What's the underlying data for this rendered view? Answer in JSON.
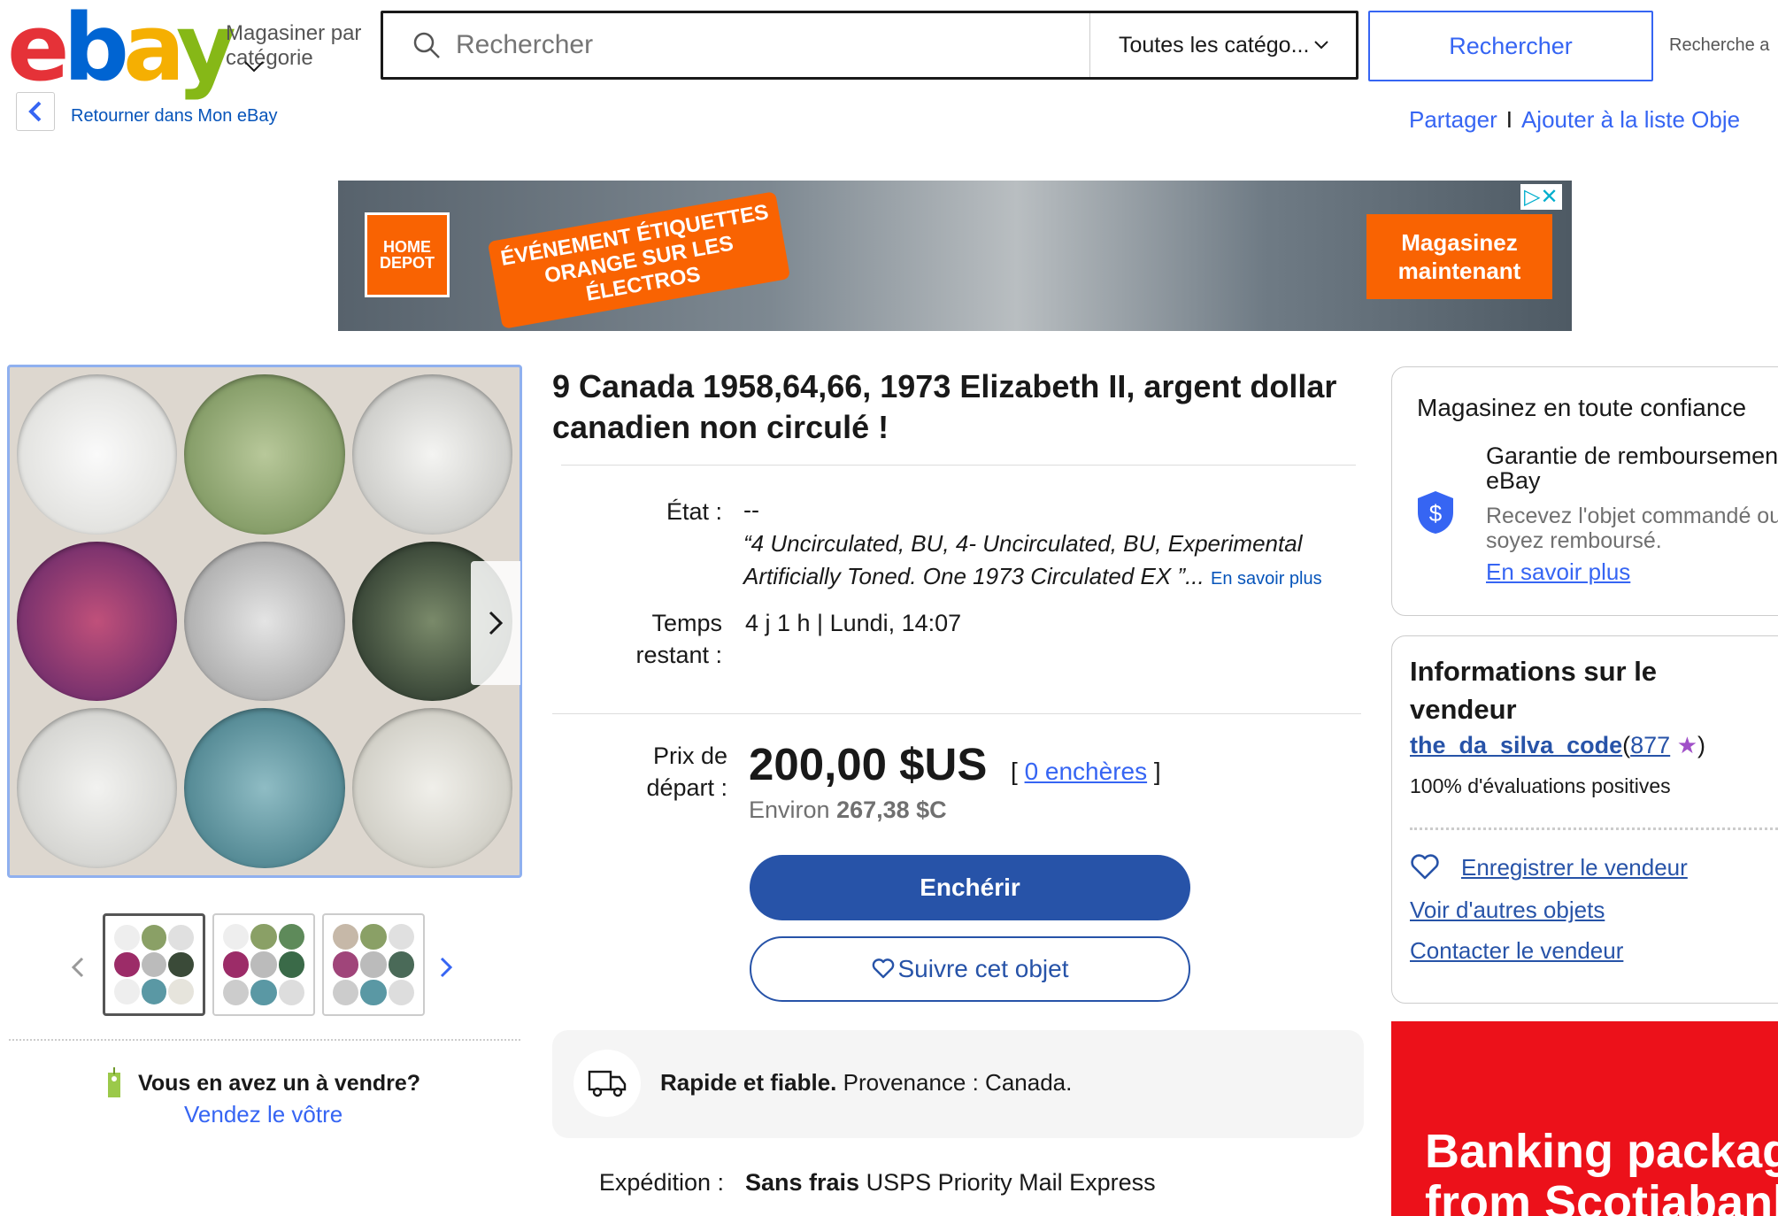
{
  "header": {
    "logo_letters": [
      "e",
      "b",
      "a",
      "y"
    ],
    "shop_by_category": "Magasiner par catégorie",
    "search_placeholder": "Rechercher",
    "category_select": "Toutes les catégo...",
    "search_button": "Rechercher",
    "advanced_search": "Recherche a"
  },
  "subnav": {
    "back_label": "Retourner dans Mon eBay",
    "share": "Partager",
    "separator": "I",
    "add_to_list": "Ajouter à la liste Obje"
  },
  "ad": {
    "brand": "HOME DEPOT",
    "headline": "ÉVÉNEMENT ÉTIQUETTES ORANGE SUR LES ÉLECTROS",
    "cta": "Magasinez maintenant",
    "adchoices": "▷✕"
  },
  "gallery": {
    "sell_question": "Vous en avez un à vendre?",
    "sell_link": "Vendez le vôtre"
  },
  "item": {
    "title": "9 Canada 1958,64,66, 1973 Elizabeth II, argent dollar canadien non circulé !",
    "condition_label": "État :",
    "condition_value": "--",
    "condition_quote": "“4 Uncirculated, BU, 4- Uncirculated, BU, Experimental Artificially Toned. One 1973 Circulated EX ”...",
    "read_more": "En savoir plus",
    "time_label": "Temps restant :",
    "time_value": "4 j 1 h | Lundi, 14:07",
    "price_label": "Prix de départ :",
    "price": "200,00 $US",
    "bids_open": "[",
    "bids": "0 enchères",
    "bids_close": "]",
    "approx_prefix": "Environ",
    "approx_value": "267,38 $C",
    "bid_button": "Enchérir",
    "watch_button": "Suivre cet objet",
    "shipping_highlight": "Rapide et fiable.",
    "shipping_origin": "Provenance : Canada.",
    "shipping_label": "Expédition :",
    "shipping_free": "Sans frais",
    "shipping_service": "USPS Priority Mail Express"
  },
  "trust": {
    "title": "Magasinez en toute confiance",
    "guarantee_title": "Garantie de remboursement eBay",
    "guarantee_text": "Recevez l'objet commandé ou soyez remboursé.",
    "learn_more": "En savoir plus"
  },
  "seller": {
    "title": "Informations sur le vendeur",
    "name": "the_da_silva_code",
    "feedback_open": "(",
    "feedback_count": "877",
    "feedback_close": ")",
    "positive": "100% d'évaluations positives",
    "save_seller": "Enregistrer le vendeur",
    "other_items": "Voir d'autres objets",
    "contact": "Contacter le vendeur"
  },
  "side_ad": {
    "text_line1": "Banking packag",
    "text_line2": "from Scotiabank"
  },
  "colors": {
    "accent": "#3665f3",
    "bid_button": "#2753a8",
    "ad_orange": "#f96302",
    "scotia_red": "#ec111a"
  }
}
